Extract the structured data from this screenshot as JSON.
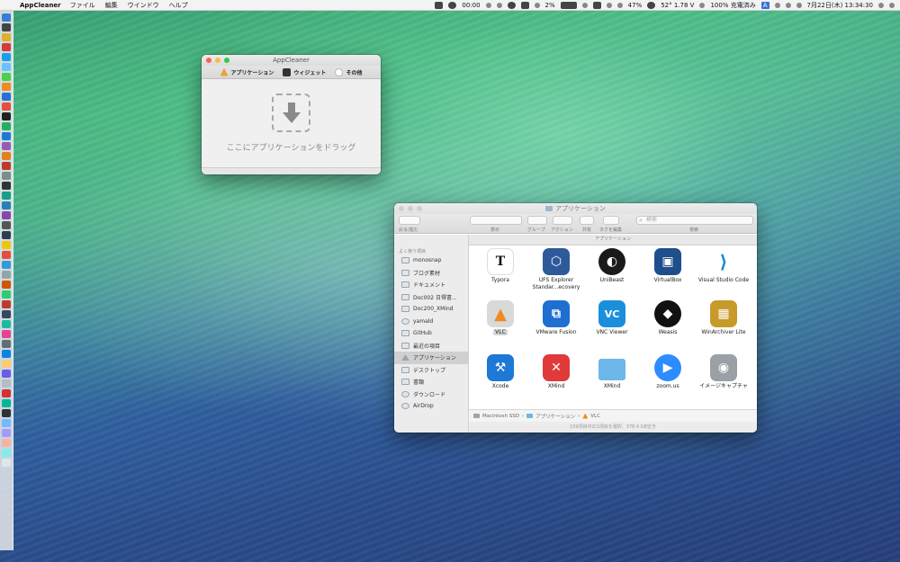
{
  "menubar": {
    "app_name": "AppCleaner",
    "menus": [
      "ファイル",
      "編集",
      "ウインドウ",
      "ヘルプ"
    ],
    "timer": "00:00",
    "battery_a": "2%",
    "battery_b": "47%",
    "temp": "52° 1.78 V",
    "battery_status": "100% 充電済み",
    "input_mode": "A",
    "datetime": "7月22日(木) 13:34:30"
  },
  "appcleaner": {
    "title": "AppCleaner",
    "tabs": [
      {
        "label": "アプリケーション",
        "icon": "apps-icon",
        "color": "#e8a33a"
      },
      {
        "label": "ウィジェット",
        "icon": "widget-icon",
        "color": "#333333"
      },
      {
        "label": "その他",
        "icon": "other-icon",
        "color": "#ffffff"
      }
    ],
    "drop_hint": "ここにアプリケーションをドラッグ"
  },
  "finder": {
    "title": "アプリケーション",
    "toolbar": {
      "back_forward": "戻る/進む",
      "view": "表示",
      "group": "グループ",
      "action": "アクション",
      "share": "共有",
      "tags": "タグを編集",
      "search_label": "検索",
      "search_placeholder": "検索"
    },
    "path_header": "アプリケーション",
    "sidebar_heading": "よく使う項目",
    "sidebar": [
      "monosnap",
      "ブログ素材",
      "ドキュメント",
      "Doc002 日得書...",
      "Doc200_XMind",
      "yamald",
      "GitHub",
      "最近の項目",
      "アプリケーション",
      "デスクトップ",
      "書類",
      "ダウンロード",
      "AirDrop"
    ],
    "apps": [
      {
        "name": "Typora",
        "icon": "typora-icon",
        "color": "#ffffff",
        "glyph": "T"
      },
      {
        "name": "UFS Explorer Standar...ecovery",
        "icon": "ufs-explorer-icon",
        "color": "#2f5a9a",
        "glyph": "⬡"
      },
      {
        "name": "UniBeast",
        "icon": "unibeast-icon",
        "color": "#1a1a1a",
        "glyph": "◐"
      },
      {
        "name": "VirtualBox",
        "icon": "virtualbox-icon",
        "color": "#1f4e8c",
        "glyph": "▣"
      },
      {
        "name": "Visual Studio Code",
        "icon": "vscode-icon",
        "color": "#ffffff",
        "glyph": "⟩"
      },
      {
        "name": "VLC",
        "icon": "vlc-icon",
        "color": "#d9d9d9",
        "glyph": "▲"
      },
      {
        "name": "VMware Fusion",
        "icon": "vmware-fusion-icon",
        "color": "#1d6fd1",
        "glyph": "⧉"
      },
      {
        "name": "VNC Viewer",
        "icon": "vnc-viewer-icon",
        "color": "#1c8fdc",
        "glyph": "VC"
      },
      {
        "name": "Weasis",
        "icon": "weasis-icon",
        "color": "#111111",
        "glyph": "◆"
      },
      {
        "name": "WinArchiver Lite",
        "icon": "winarchiver-icon",
        "color": "#c89a2a",
        "glyph": "▦"
      },
      {
        "name": "Xcode",
        "icon": "xcode-icon",
        "color": "#1e78d6",
        "glyph": "⚒"
      },
      {
        "name": "XMind",
        "icon": "xmind-icon",
        "color": "#e03a3a",
        "glyph": "✕"
      },
      {
        "name": "XMind",
        "icon": "folder-icon",
        "color": "#6cb6ea",
        "glyph": ""
      },
      {
        "name": "zoom.us",
        "icon": "zoom-icon",
        "color": "#2d8cff",
        "glyph": "▶"
      },
      {
        "name": "イメージキャプチャ",
        "icon": "image-capture-icon",
        "color": "#9aa0a6",
        "glyph": "◉"
      }
    ],
    "pathbar": [
      "Macintosh SSD",
      "アプリケーション",
      "VLC"
    ],
    "status": "159項目中の1項目を選択、378.4 GB空き"
  }
}
